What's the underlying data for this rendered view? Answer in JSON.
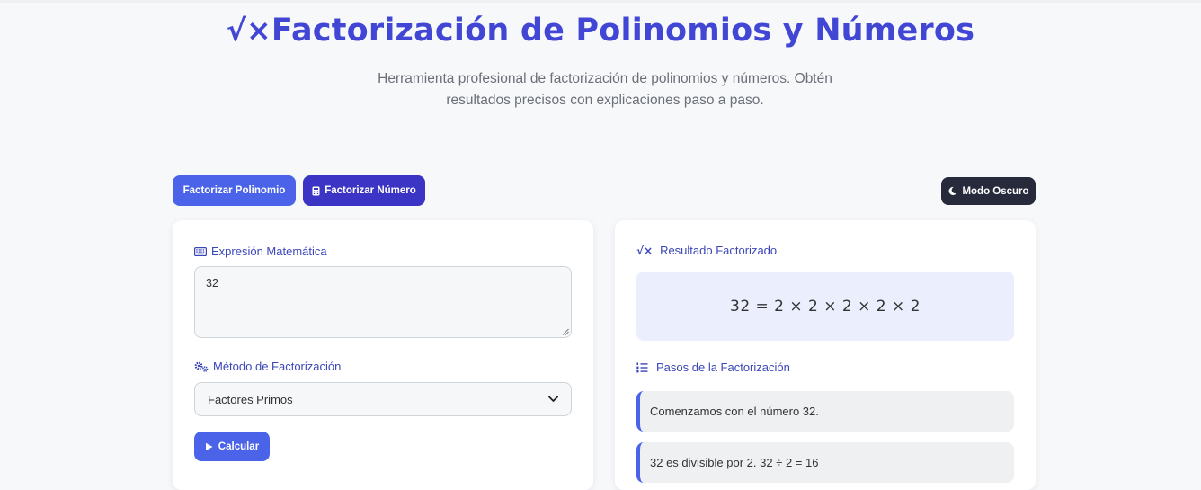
{
  "header": {
    "logo_glyph": "√×",
    "title": "Factorización de Polinomios y Números",
    "subtitle": "Herramienta profesional de factorización de polinomios y números. Obtén resultados precisos con explicaciones paso a paso."
  },
  "toolbar": {
    "poly_label": "Factorizar Polinomio",
    "number_label": "Factorizar Número",
    "dark_mode_label": "Modo Oscuro"
  },
  "input_panel": {
    "expression_label": "Expresión Matemática",
    "expression_value": "32",
    "method_label": "Método de Factorización",
    "method_selected": "Factores Primos",
    "calculate_label": "Calcular"
  },
  "result_panel": {
    "result_icon": "√×",
    "result_label": "Resultado Factorizado",
    "result_value": "32 = 2 × 2 × 2 × 2 × 2",
    "steps_label": "Pasos de la Factorización",
    "steps": [
      "Comenzamos con el número 32.",
      "32 es divisible por 2. 32 ÷ 2 = 16"
    ]
  },
  "colors": {
    "accent": "#4a63e8",
    "accent_dark": "#3c34c4",
    "title": "#4147d4",
    "dark_button": "#262a3b",
    "result_bg": "#eaeefd"
  },
  "icons": [
    "sqrt-x-icon",
    "calculator-icon",
    "moon-icon",
    "keyboard-icon",
    "gears-icon",
    "chevron-down-icon",
    "play-icon",
    "list-ol-icon"
  ]
}
